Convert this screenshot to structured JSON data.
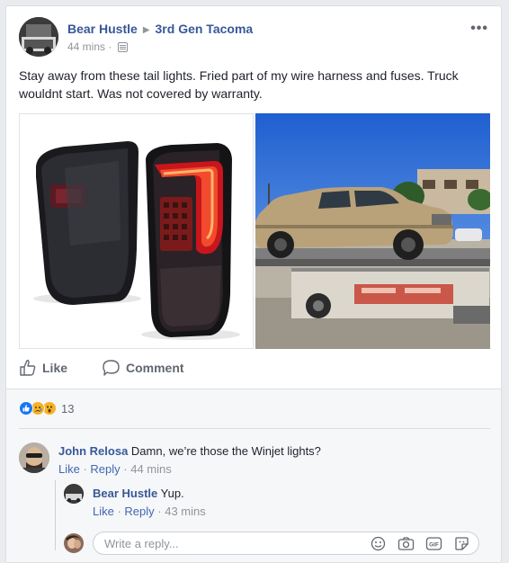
{
  "post": {
    "author": "Bear Hustle",
    "group": "3rd Gen Tacoma",
    "time": "44 mins ·",
    "text": "Stay away from these tail lights. Fried part of my wire harness and fuses. Truck wouldnt start. Was not covered by warranty."
  },
  "actions": {
    "like": "Like",
    "comment": "Comment"
  },
  "reactions": {
    "icons": [
      "like-reaction",
      "sad-reaction",
      "wow-reaction"
    ],
    "count": "13"
  },
  "comments": [
    {
      "author": "John Relosa",
      "text": "Damn, we’re those the Winjet lights?",
      "like": "Like",
      "reply": "Reply",
      "time": "44 mins"
    }
  ],
  "replies": [
    {
      "author": "Bear Hustle",
      "text": "Yup.",
      "like": "Like",
      "reply": "Reply",
      "time": "43 mins"
    }
  ],
  "reply_box": {
    "placeholder": "Write a reply..."
  },
  "colors": {
    "link": "#385898",
    "muted": "#90949c",
    "like_blue": "#1877f2",
    "reaction_yellow": "#f7b125"
  }
}
